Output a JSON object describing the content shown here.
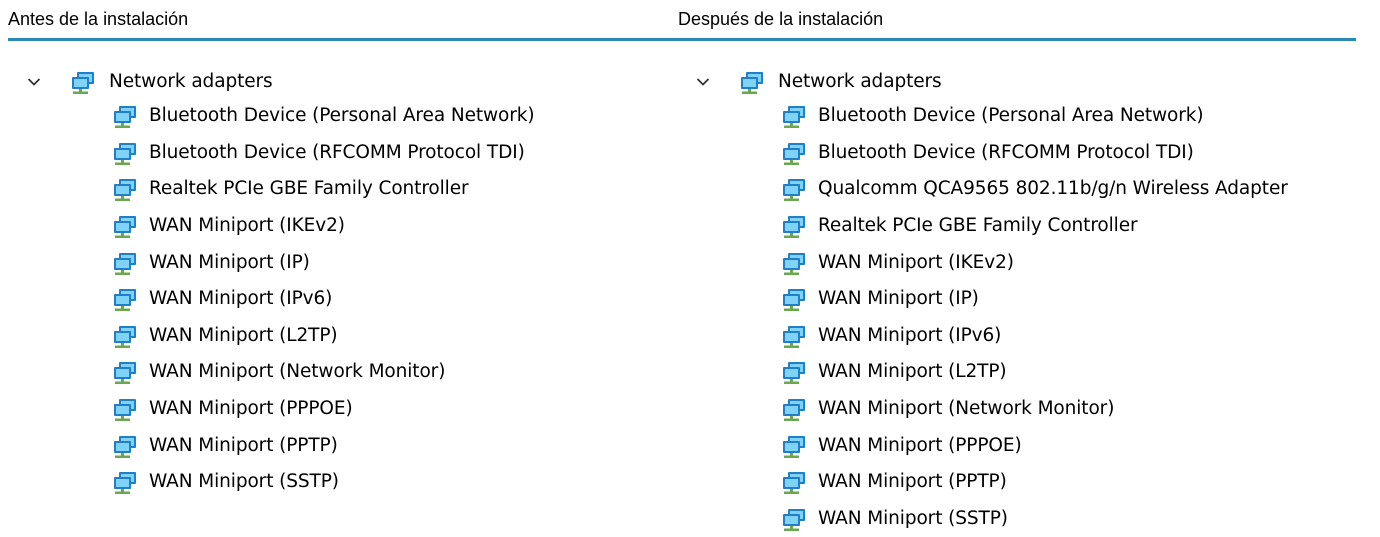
{
  "columns": [
    {
      "heading": "Antes de la instalación",
      "root_label": "Network adapters",
      "items": [
        "Bluetooth Device (Personal Area Network)",
        "Bluetooth Device (RFCOMM Protocol TDI)",
        "Realtek PCIe GBE Family Controller",
        "WAN Miniport (IKEv2)",
        "WAN Miniport (IP)",
        "WAN Miniport (IPv6)",
        "WAN Miniport (L2TP)",
        "WAN Miniport (Network Monitor)",
        "WAN Miniport (PPPOE)",
        "WAN Miniport (PPTP)",
        "WAN Miniport (SSTP)"
      ]
    },
    {
      "heading": "Después de la instalación",
      "root_label": "Network adapters",
      "items": [
        "Bluetooth Device (Personal Area Network)",
        "Bluetooth Device (RFCOMM Protocol TDI)",
        "Qualcomm QCA9565 802.11b/g/n Wireless Adapter",
        "Realtek PCIe GBE Family Controller",
        "WAN Miniport (IKEv2)",
        "WAN Miniport (IP)",
        "WAN Miniport (IPv6)",
        "WAN Miniport (L2TP)",
        "WAN Miniport (Network Monitor)",
        "WAN Miniport (PPPOE)",
        "WAN Miniport (PPTP)",
        "WAN Miniport (SSTP)"
      ]
    }
  ],
  "icons": {
    "expander": "chevron-down-icon",
    "adapter": "network-adapter-icon"
  },
  "colors": {
    "divider": "#2b88b5",
    "monitor_frame": "#1f7fc8",
    "monitor_screen": "#7fd3f7",
    "stand": "#6aa84f"
  }
}
